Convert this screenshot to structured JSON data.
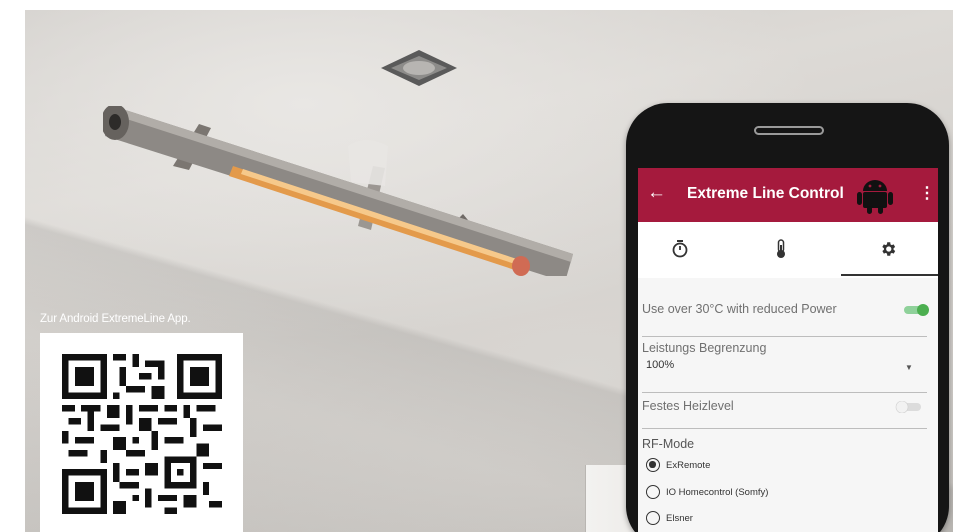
{
  "qr": {
    "caption": "Zur Android ExtremeLine App."
  },
  "app": {
    "title": "Extreme Line Control",
    "back_icon": "arrow-back-icon",
    "more_icon": "more-vert-icon",
    "tabs": [
      {
        "icon": "timer-icon"
      },
      {
        "icon": "thermometer-icon"
      },
      {
        "icon": "gear-icon",
        "selected": true
      }
    ],
    "settings": {
      "reduced_power_label": "Use over 30°C with reduced Power",
      "reduced_power_enabled": true,
      "power_limit_label": "Leistungs Begrenzung",
      "power_limit_value": "100%",
      "fixed_level_label": "Festes Heizlevel",
      "fixed_level_enabled": false,
      "rf_mode_label": "RF-Mode",
      "rf_options": [
        {
          "label": "ExRemote",
          "checked": true
        },
        {
          "label": "IO Homecontrol (Somfy)",
          "checked": false
        },
        {
          "label": "Elsner",
          "checked": false
        }
      ]
    },
    "colors": {
      "appbar": "#a51a3d",
      "toggle_on": "#4caf50"
    }
  }
}
